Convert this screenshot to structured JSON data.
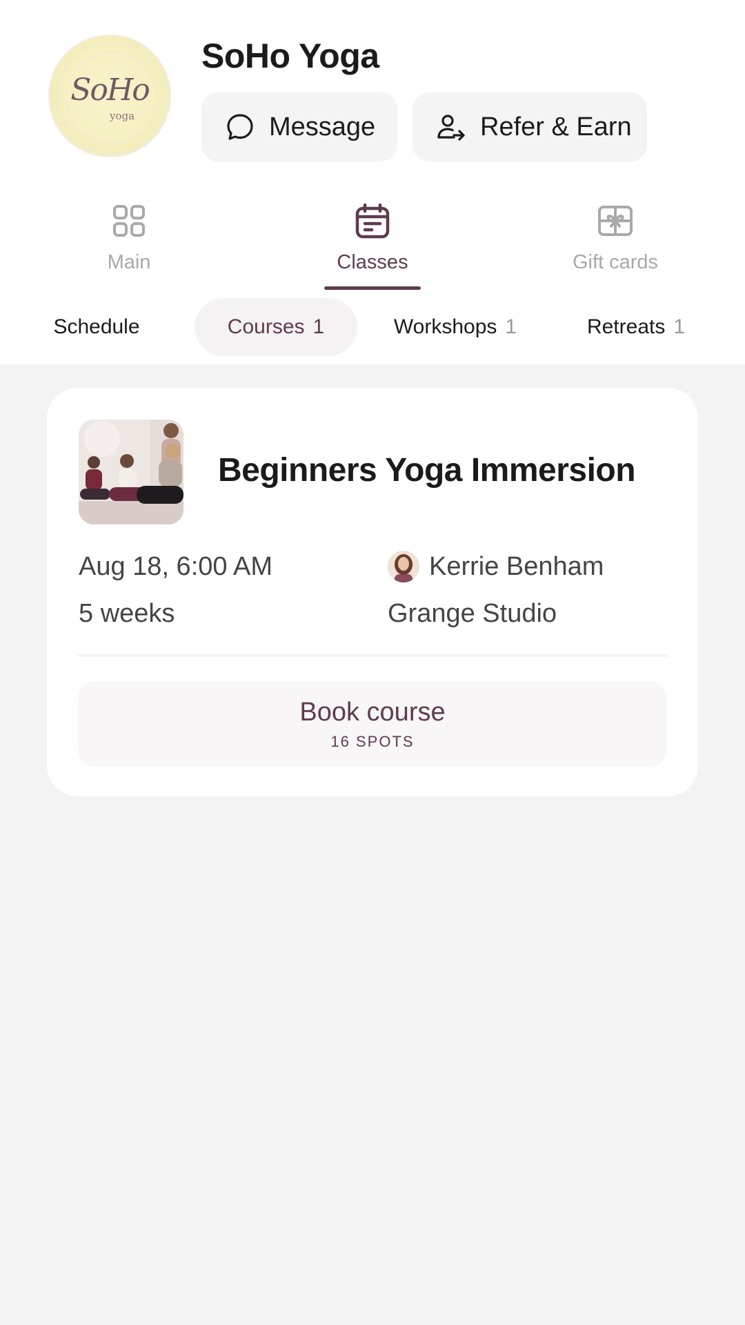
{
  "header": {
    "studio_name": "SoHo Yoga",
    "logo_text": "SoHo",
    "logo_subtext": "yoga",
    "message_label": "Message",
    "refer_label": "Refer & Earn"
  },
  "main_tabs": [
    {
      "label": "Main",
      "icon": "grid-icon",
      "active": false
    },
    {
      "label": "Classes",
      "icon": "calendar-icon",
      "active": true
    },
    {
      "label": "Gift cards",
      "icon": "gift-card-icon",
      "active": false
    }
  ],
  "sub_tabs": [
    {
      "label": "Schedule",
      "count": ""
    },
    {
      "label": "Courses",
      "count": "1",
      "active": true
    },
    {
      "label": "Workshops",
      "count": "1"
    },
    {
      "label": "Retreats",
      "count": "1"
    }
  ],
  "course": {
    "title": "Beginners Yoga Immersion",
    "date": "Aug 18, 6:00 AM",
    "duration": "5 weeks",
    "teacher": "Kerrie Benham",
    "location": "Grange Studio",
    "book_label": "Book course",
    "spots": "16 SPOTS"
  },
  "colors": {
    "accent": "#5e3b4e",
    "background": "#f3f3f3",
    "card": "#ffffff",
    "logo_bg": "#f6f0c1"
  }
}
